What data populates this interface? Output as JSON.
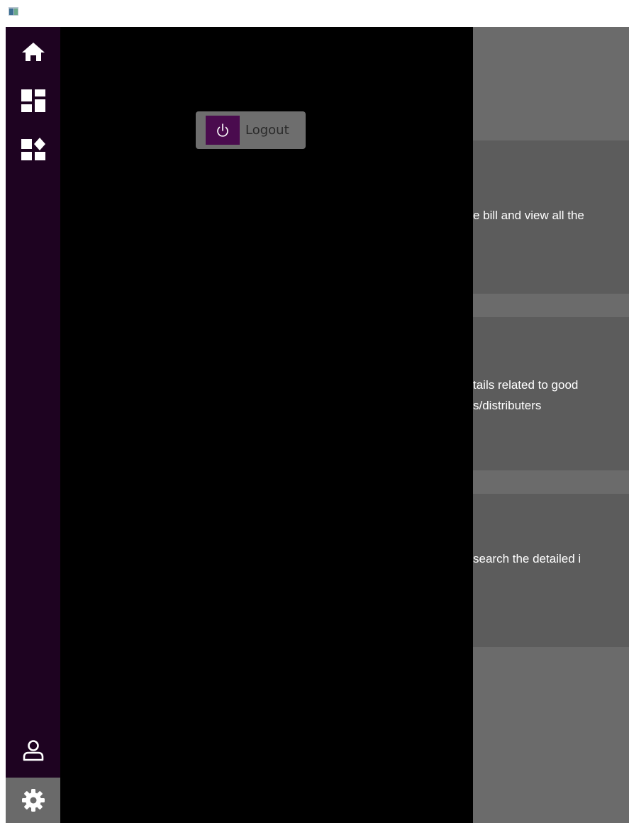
{
  "sidebar": {
    "items": [
      {
        "icon": "home-icon"
      },
      {
        "icon": "dashboard-icon"
      },
      {
        "icon": "apps-add-icon"
      }
    ],
    "bottom": [
      {
        "icon": "user-icon"
      },
      {
        "icon": "gear-icon",
        "selected": true
      }
    ]
  },
  "settings_pane": {
    "logout_label": "Logout",
    "logout_icon": "power-icon"
  },
  "main": {
    "cards": [
      {
        "lines": [
          "e bill and view all the"
        ]
      },
      {
        "lines": [
          "tails related to good",
          "s/distributers"
        ]
      },
      {
        "lines": [
          "search the detailed i"
        ]
      }
    ]
  },
  "colors": {
    "sidebar_bg": "#1e0321",
    "pane_bg": "#000000",
    "accent": "#4a0b4e",
    "content_bg": "#6b6b6b",
    "card_bg": "#5c5c5c",
    "selected_bg": "#6a6a6a"
  }
}
